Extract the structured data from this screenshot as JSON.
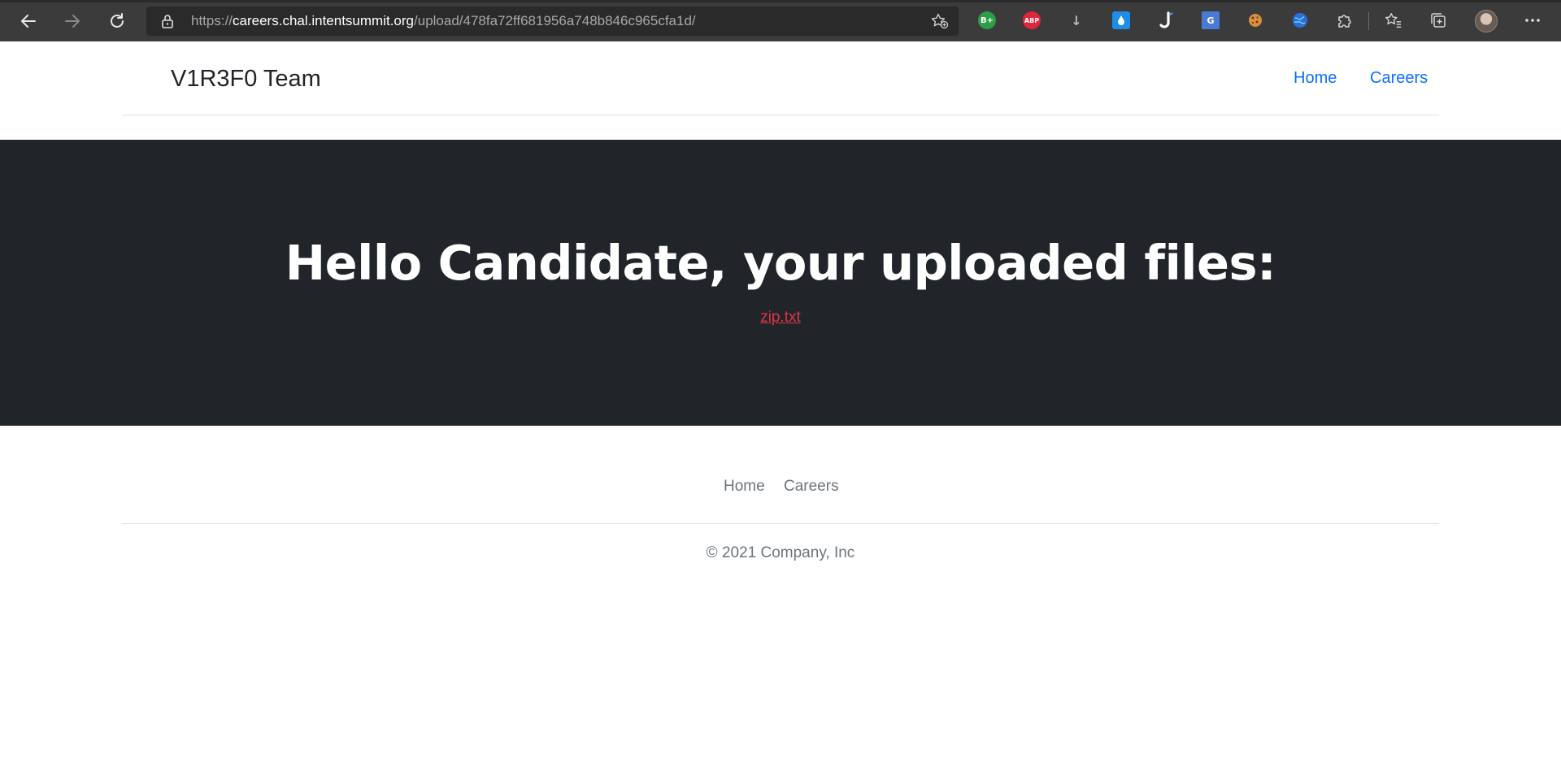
{
  "browser": {
    "url_scheme": "https://",
    "url_host": "careers.chal.intentsummit.org",
    "url_path": "/upload/478fa72ff681956a748b846c965cfa1d/",
    "extensions": [
      {
        "name": "grammarly-extension-icon",
        "label": "B+",
        "color": "#2e9d49"
      },
      {
        "name": "adblock-plus-icon",
        "label": "ABP",
        "color": "#e0263e"
      },
      {
        "name": "download-icon",
        "label": "↓",
        "color": "#3b3b3b"
      },
      {
        "name": "raindrop-icon",
        "label": "💧",
        "color": "#1f8ce6"
      },
      {
        "name": "j-extension-icon",
        "label": "J",
        "color": "#1a4f9c"
      },
      {
        "name": "google-translate-icon",
        "label": "G",
        "color": "#4a7bd4"
      },
      {
        "name": "cookie-icon",
        "label": "🍪",
        "color": "#3b3b3b"
      },
      {
        "name": "globe-extension-icon",
        "label": "",
        "color": "#2a6fd6"
      }
    ]
  },
  "header": {
    "brand": "V1R3F0 Team",
    "nav": [
      "Home",
      "Careers"
    ]
  },
  "hero": {
    "title": "Hello Candidate, your uploaded files:",
    "file_link": "zip.txt"
  },
  "footer": {
    "nav": [
      "Home",
      "Careers"
    ],
    "copyright": "© 2021 Company, Inc"
  },
  "colors": {
    "hero_bg": "#212529",
    "link_primary": "#0d6efd",
    "link_danger": "#dc3545",
    "muted": "#6c757d"
  }
}
